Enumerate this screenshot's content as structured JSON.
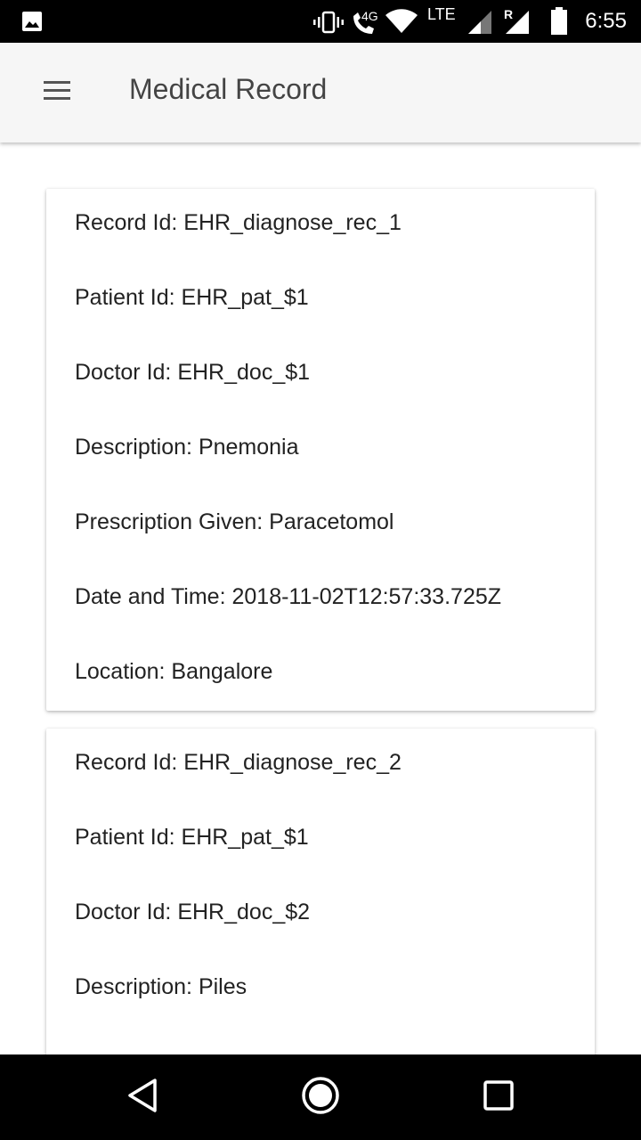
{
  "status_bar": {
    "time": "6:55",
    "network_label": "4G",
    "lte_label": "LTE",
    "roaming_label": "R",
    "icons": [
      "image-icon",
      "vibrate-icon",
      "wifi-calling-icon",
      "wifi-icon",
      "signal-icon",
      "signal-roaming-icon",
      "battery-icon"
    ]
  },
  "app_bar": {
    "title": "Medical Record",
    "menu_icon": "menu-icon"
  },
  "records": [
    {
      "record_id": "Record Id: EHR_diagnose_rec_1",
      "patient_id": "Patient Id: EHR_pat_$1",
      "doctor_id": "Doctor Id: EHR_doc_$1",
      "description": "Description: Pnemonia",
      "prescription": "Prescription Given: Paracetomol",
      "date_time": "Date and Time: 2018-11-02T12:57:33.725Z",
      "location": "Location: Bangalore"
    },
    {
      "record_id": "Record Id: EHR_diagnose_rec_2",
      "patient_id": "Patient Id: EHR_pat_$1",
      "doctor_id": "Doctor Id: EHR_doc_$2",
      "description": "Description: Piles"
    }
  ],
  "nav_bar": {
    "icons": [
      "back-icon",
      "home-icon",
      "recents-icon"
    ]
  },
  "colors": {
    "status_bar_bg": "#000000",
    "app_bar_bg": "#f6f6f6",
    "title_text": "#444444",
    "body_text": "#222222"
  }
}
